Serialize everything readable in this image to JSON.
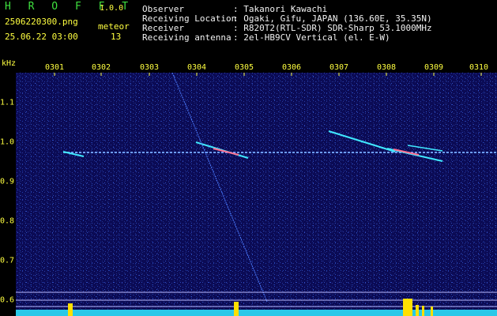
{
  "app": {
    "name": "H R O F F T",
    "version": "1.0.0"
  },
  "file": {
    "name": "2506220300.png",
    "datetime": "25.06.22 03:00"
  },
  "counter": {
    "label": "meteor",
    "value": "13"
  },
  "info": {
    "observer_label": "Observer",
    "observer_value": ": Takanori Kawachi",
    "location_label": "Receiving Location",
    "location_value": ": Ogaki, Gifu, JAPAN (136.60E, 35.35N)",
    "receiver_label": "Receiver",
    "receiver_value": ": R820T2(RTL-SDR) SDR-Sharp 53.1000MHz",
    "antenna_label": "Receiving antenna",
    "antenna_value": ": 2el-HB9CV Vertical (el. E-W)"
  },
  "axis": {
    "y_unit": "kHz",
    "x_ticks": [
      "0301",
      "0302",
      "0303",
      "0304",
      "0305",
      "0306",
      "0307",
      "0308",
      "0309",
      "0310"
    ],
    "y_ticks": [
      "1.1",
      "1.0",
      "0.9",
      "0.8",
      "0.7",
      "0.6"
    ]
  },
  "colors": {
    "header_green": "#3fe03f",
    "header_yellow": "#ffff40",
    "background": "#000000",
    "plot_bg": "#0b0b55",
    "signal": "#2ee8ff"
  }
}
